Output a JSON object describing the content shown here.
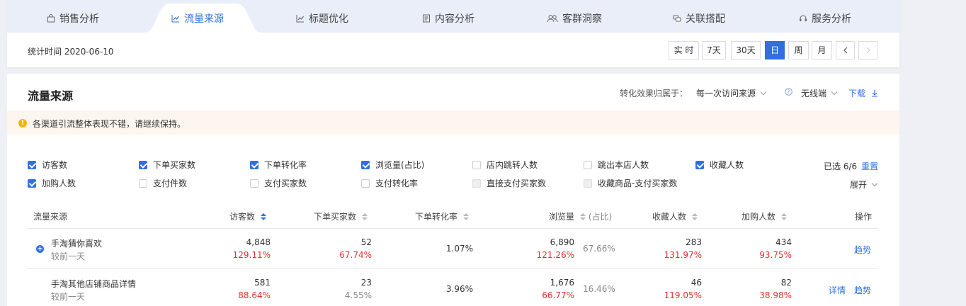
{
  "tabs": [
    {
      "label": "销售分析",
      "icon": "bag-icon"
    },
    {
      "label": "流量来源",
      "icon": "trend-icon",
      "active": true
    },
    {
      "label": "标题优化",
      "icon": "line-chart-icon"
    },
    {
      "label": "内容分析",
      "icon": "document-icon"
    },
    {
      "label": "客群洞察",
      "icon": "users-icon"
    },
    {
      "label": "关联搭配",
      "icon": "link-icon"
    },
    {
      "label": "服务分析",
      "icon": "headset-icon"
    }
  ],
  "stat_time": "统计时间 2020-06-10",
  "period_buttons": [
    "实 时",
    "7天",
    "30天",
    "日",
    "周",
    "月"
  ],
  "period_selected": "日",
  "section": {
    "title": "流量来源",
    "attribution_label": "转化效果归属于：",
    "attribution_value": "每一次访问来源",
    "terminal_value": "无线端",
    "download_label": "下载"
  },
  "notice": "各渠道引流整体表现不错，请继续保持。",
  "metrics_row1": [
    {
      "label": "访客数",
      "checked": true
    },
    {
      "label": "下单买家数",
      "checked": true
    },
    {
      "label": "下单转化率",
      "checked": true
    },
    {
      "label": "浏览量(占比)",
      "checked": true
    },
    {
      "label": "店内跳转人数",
      "checked": false
    },
    {
      "label": "跳出本店人数",
      "checked": false
    },
    {
      "label": "收藏人数",
      "checked": true
    }
  ],
  "metrics_row2": [
    {
      "label": "加购人数",
      "checked": true
    },
    {
      "label": "支付件数",
      "checked": false
    },
    {
      "label": "支付买家数",
      "checked": false
    },
    {
      "label": "支付转化率",
      "checked": false
    },
    {
      "label": "直接支付买家数",
      "checked": false,
      "disabled": true
    },
    {
      "label": "收藏商品-支付买家数",
      "checked": false,
      "disabled": true
    }
  ],
  "selected_text": "已选 6/6",
  "reset_label": "重置",
  "expand_label": "展开",
  "table": {
    "headers": [
      "流量来源",
      "访客数",
      "下单买家数",
      "下单转化率",
      "浏览量",
      "(占比)",
      "收藏人数",
      "加购人数",
      "操作"
    ],
    "rows": [
      {
        "source": "手淘猜你喜欢",
        "compare": "较前一天",
        "visitors": "4,848",
        "visitors_change": "129.11%",
        "buyers": "52",
        "buyers_change": "67.74%",
        "conversion": "1.07%",
        "pv": "6,890",
        "pv_change": "121.26%",
        "pv_share": "67.66%",
        "favorites": "283",
        "favorites_change": "131.97%",
        "cart": "434",
        "cart_change": "93.75%",
        "actions": [
          "趋势"
        ]
      },
      {
        "source": "手淘其他店铺商品详情",
        "compare": "较前一天",
        "visitors": "581",
        "visitors_change": "88.64%",
        "buyers": "23",
        "buyers_change": "4.55%",
        "conversion": "3.96%",
        "pv": "1,676",
        "pv_change": "66.77%",
        "pv_share": "16.46%",
        "favorites": "46",
        "favorites_change": "119.05%",
        "cart": "82",
        "cart_change": "38.98%",
        "actions": [
          "详情",
          "趋势"
        ]
      }
    ]
  },
  "colors": {
    "accent": "#2f6fe0",
    "up": "#e3302f",
    "notice_bg": "#fdf6ee",
    "warning": "#f5b400"
  }
}
